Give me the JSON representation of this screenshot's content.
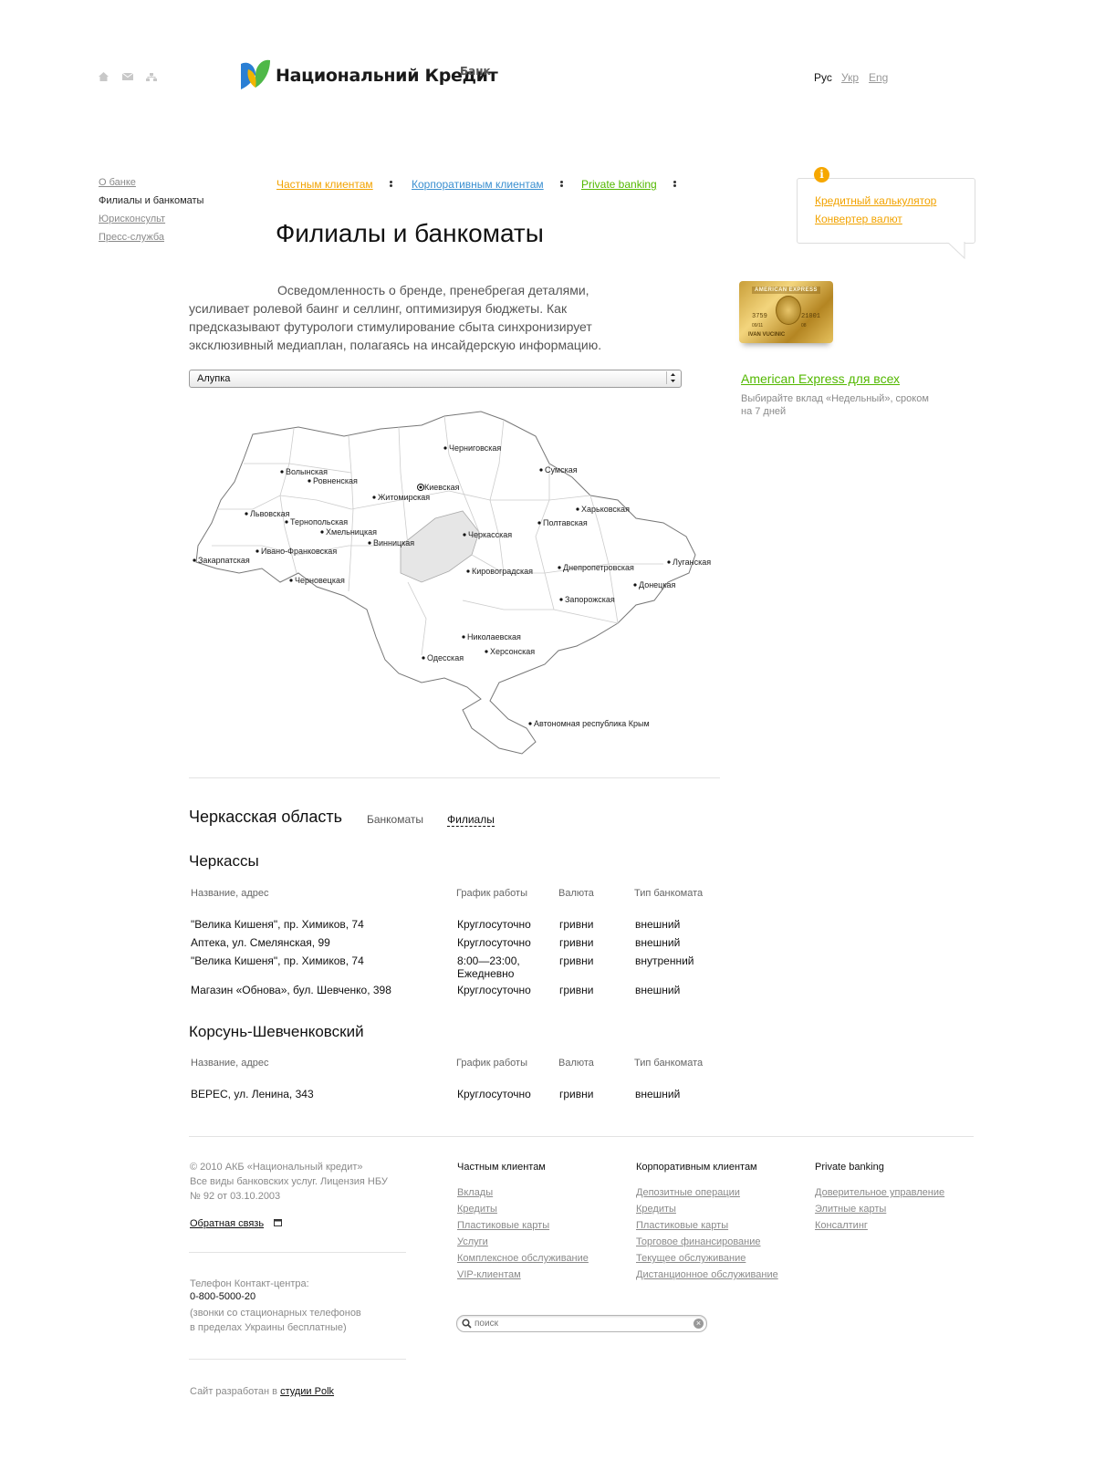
{
  "header": {
    "icons": [
      "home-icon",
      "mail-icon",
      "sitemap-icon"
    ],
    "logo_text": "Национальний Кредит",
    "logo_sup": "Банк",
    "languages": [
      {
        "label": "Рус",
        "active": true
      },
      {
        "label": "Укр",
        "active": false
      },
      {
        "label": "Eng",
        "active": false
      }
    ]
  },
  "sidebar": {
    "items": [
      {
        "label": "О банке"
      },
      {
        "label": "Филиалы и банкоматы"
      },
      {
        "label": "Юрисконсульт"
      },
      {
        "label": "Пресс-служба"
      }
    ]
  },
  "topnav": {
    "private": "Частным клиентам",
    "corporate": "Корпоративным клиентам",
    "private_banking": "Private banking"
  },
  "page": {
    "title": "Филиалы и банкоматы",
    "intro": "Осведомленность о бренде, пренебрегая деталями, усиливает ролевой баинг и селлинг, оптимизируя бюджеты. Как предсказывают футурологи стимулирование сбыта синхронизирует эксклюзивный медиаплан, полагаясь на инсайдерскую информацию.",
    "city_select": "Алупка"
  },
  "info_box": {
    "calculator": "Кредитный калькулятор",
    "converter": "Конвертер валют"
  },
  "promo": {
    "card_brand": "AMERICAN EXPRESS",
    "card_number_left": "3759",
    "card_number_right": "21001",
    "card_holder": "IVAN VUCINIC",
    "card_valid": "09/11",
    "card_code": "08",
    "link": "American Express для всех",
    "text": "Выбирайте вклад «Недельный», сроком на 7 дней"
  },
  "map": {
    "regions": [
      "Черниговская",
      "Сумская",
      "Волынская",
      "Ровненская",
      "Киевская",
      "Житомирская",
      "Харьковская",
      "Львовская",
      "Тернопольская",
      "Полтавская",
      "Хмельницкая",
      "Черкасская",
      "Винницкая",
      "Ивано-Франковская",
      "Луганская",
      "Закарпатская",
      "Днепропетровская",
      "Кировоградская",
      "Черновецкая",
      "Донецкая",
      "Запорожская",
      "Николаевская",
      "Херсонская",
      "Одесская",
      "Автономная республика Крым"
    ],
    "highlighted": "Черкасская"
  },
  "results": {
    "region_title": "Черкасская область",
    "tab_atm": "Банкоматы",
    "tab_branches": "Филиалы",
    "columns": [
      "Название, адрес",
      "График работы",
      "Валюта",
      "Тип банкомата"
    ],
    "cities": [
      {
        "name": "Черкассы",
        "rows": [
          {
            "address": "\"Велика Кишеня\", пр. Химиков, 74",
            "schedule": "Круглосуточно",
            "schedule2": "",
            "currency": "гривни",
            "type": "внешний"
          },
          {
            "address": "Аптека, ул. Смелянская, 99",
            "schedule": "Круглосуточно",
            "schedule2": "",
            "currency": "гривни",
            "type": "внешний"
          },
          {
            "address": "\"Велика Кишеня\", пр. Химиков, 74",
            "schedule": "8:00—23:00,",
            "schedule2": "Ежедневно",
            "currency": "гривни",
            "type": "внутренний"
          },
          {
            "address": "Магазин «Обнова», бул. Шевченко, 398",
            "schedule": "Круглосуточно",
            "schedule2": "",
            "currency": "гривни",
            "type": "внешний"
          }
        ]
      },
      {
        "name": "Корсунь-Шевченковский",
        "rows": [
          {
            "address": "ВЕРЕС, ул. Ленина, 343",
            "schedule": "Круглосуточно",
            "schedule2": "",
            "currency": "гривни",
            "type": "внешний"
          }
        ]
      }
    ]
  },
  "footer": {
    "copyright1": "© 2010 АКБ «Национальный кредит»",
    "copyright2": "Все виды банковских услуг. Лицензия НБУ",
    "copyright3": "№ 92 от 03.10.2003",
    "feedback": "Обратная связь",
    "phone_label": "Телефон Контакт-центра:",
    "phone": "0-800-5000-20",
    "phone_note1": "(звонки со стационарных телефонов",
    "phone_note2": "в пределах Украины бесплатные)",
    "dev_prefix": "Сайт разработан в",
    "dev_link": "студии Polk",
    "col1": {
      "head": "Частным клиентам",
      "links": [
        "Вклады",
        "Кредиты",
        "Пластиковые карты",
        "Услуги",
        "Комплексное обслуживание",
        "VIP-клиентам"
      ]
    },
    "col2": {
      "head": "Корпоративным клиентам",
      "links": [
        "Депозитные операции",
        "Кредиты",
        "Пластиковые карты",
        "Торговое финансирование",
        "Текущее обслуживание",
        "Дистанционное обслуживание"
      ]
    },
    "col3": {
      "head": "Private banking",
      "links": [
        "Доверительное управление",
        "Элитные карты",
        "Консалтинг"
      ]
    },
    "search_placeholder": "поиск"
  }
}
